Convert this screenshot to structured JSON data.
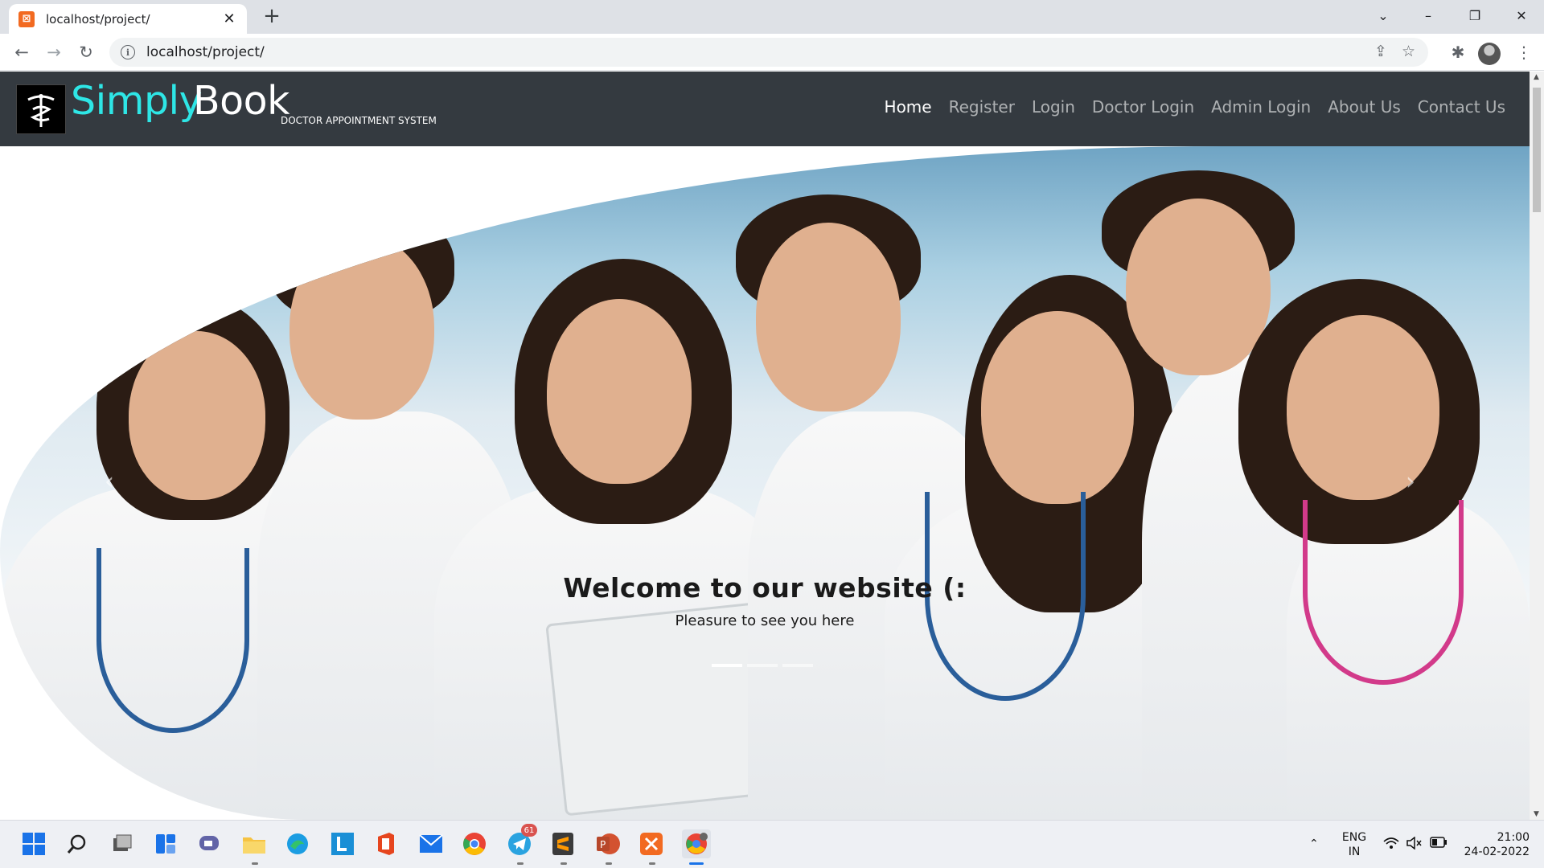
{
  "browser": {
    "tab_title": "localhost/project/",
    "tab_favicon_glyph": "⊠",
    "url": "localhost/project/",
    "new_tab_glyph": "+",
    "tab_close_glyph": "✕",
    "window_controls": {
      "tablist": "⌄",
      "minimize": "–",
      "restore": "❐",
      "close": "✕"
    },
    "nav": {
      "back": "←",
      "forward": "→",
      "reload": "↻"
    },
    "omni_info_glyph": "i",
    "omni_icons": {
      "share": "⇪",
      "bookmark": "☆"
    },
    "toolbar_icons": {
      "extensions": "✱",
      "menu": "⋮"
    }
  },
  "site": {
    "brand_primary": "Simply",
    "brand_secondary": "Book",
    "brand_tagline": "DOCTOR APPOINTMENT SYSTEM",
    "brand_primary_color": "#2ee6e6",
    "navbar_color": "#343a40",
    "nav_links": [
      "Home",
      "Register",
      "Login",
      "Doctor Login",
      "Admin Login",
      "About Us",
      "Contact Us"
    ],
    "active_link": "Home"
  },
  "hero": {
    "title": "Welcome to our website (:",
    "subtitle": "Pleasure to see you here",
    "prev_glyph": "‹",
    "next_glyph": "›",
    "slide_count": 3,
    "active_slide": 1
  },
  "taskbar": {
    "icons": [
      "windows-start-icon",
      "search-icon",
      "task-view-icon",
      "widgets-icon",
      "teams-chat-icon",
      "file-explorer-icon",
      "edge-icon",
      "l-app-icon",
      "office-icon",
      "mail-icon",
      "chrome-icon",
      "telegram-icon",
      "sublime-text-icon",
      "powerpoint-icon",
      "xampp-icon",
      "chrome-profile-icon"
    ],
    "telegram_badge": "61",
    "tray": {
      "chevron": "⌃",
      "language": "ENG",
      "region": "IN",
      "wifi": "◠",
      "volume": "🔇",
      "battery": "▭",
      "time": "21:00",
      "date": "24-02-2022"
    }
  }
}
